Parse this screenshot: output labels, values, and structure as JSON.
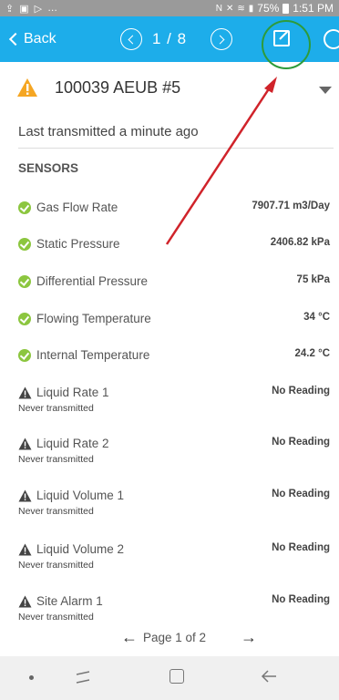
{
  "status_bar": {
    "time": "1:51 PM",
    "battery": "75%"
  },
  "nav": {
    "back_label": "Back",
    "pager": "1 / 8"
  },
  "well": {
    "title": "100039 AEUB #5",
    "last_transmitted": "Last transmitted a minute ago"
  },
  "sensors": {
    "heading": "SENSORS",
    "items": [
      {
        "label": "Gas Flow Rate",
        "value": "7907.71 m3/Day",
        "status": "ok"
      },
      {
        "label": "Static Pressure",
        "value": "2406.82 kPa",
        "status": "ok"
      },
      {
        "label": "Differential Pressure",
        "value": "75 kPa",
        "status": "ok"
      },
      {
        "label": "Flowing Temperature",
        "value": "34 °C",
        "status": "ok"
      },
      {
        "label": "Internal Temperature",
        "value": "24.2 °C",
        "status": "ok"
      },
      {
        "label": "Liquid Rate 1",
        "value": "No Reading",
        "sub": "Never transmitted",
        "status": "alert"
      },
      {
        "label": "Liquid Rate 2",
        "value": "No Reading",
        "sub": "Never transmitted",
        "status": "alert"
      },
      {
        "label": "Liquid Volume 1",
        "value": "No Reading",
        "sub": "Never transmitted",
        "status": "alert"
      },
      {
        "label": "Liquid Volume 2",
        "value": "No Reading",
        "sub": "Never transmitted",
        "status": "alert"
      },
      {
        "label": "Site Alarm 1",
        "value": "No Reading",
        "sub": "Never transmitted",
        "status": "alert"
      }
    ]
  },
  "pagination": {
    "label": "Page 1 of 2"
  },
  "icons": {
    "status_left": [
      "upload-icon",
      "image-icon",
      "play-store-icon"
    ],
    "status_right": [
      "nfc-icon",
      "mute-icon",
      "wifi-icon",
      "signal-icon",
      "battery-icon"
    ],
    "nav": [
      "back-chevron-icon",
      "prev-circle-icon",
      "next-circle-icon",
      "edit-icon",
      "refresh-icon"
    ],
    "well": [
      "warning-icon",
      "caret-down-icon"
    ],
    "system_nav": [
      "dot-icon",
      "recents-icon",
      "home-icon",
      "back-icon"
    ]
  },
  "colors": {
    "nav_bar": "#1dadea",
    "warning": "#f5a623",
    "ok": "#8cc63f",
    "annotation_arrow": "#d0232a",
    "highlight_circle": "#2e9b3a"
  }
}
